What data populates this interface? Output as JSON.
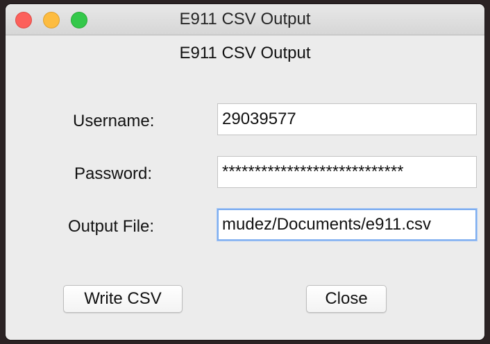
{
  "window": {
    "title": "E911 CSV Output"
  },
  "form": {
    "heading": "E911 CSV Output",
    "username_label": "Username:",
    "username_value": "29039577",
    "password_label": "Password:",
    "password_value": "****************************",
    "output_file_label": "Output File:",
    "output_file_value": "mudez/Documents/e911.csv"
  },
  "buttons": {
    "write_csv": "Write CSV",
    "close": "Close"
  },
  "colors": {
    "close_light": "#fc605b",
    "minimize_light": "#fdbc40",
    "maximize_light": "#34c84a",
    "focus_ring": "#7eaef0"
  }
}
